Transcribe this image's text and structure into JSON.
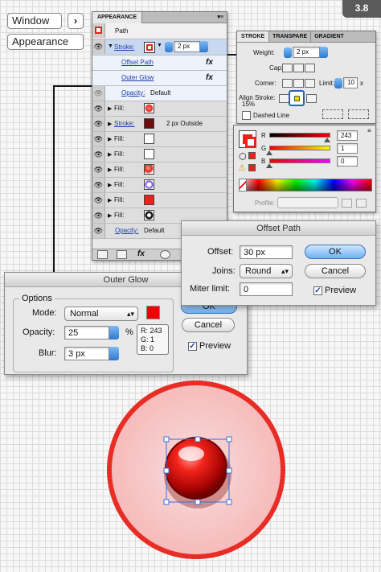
{
  "header": {
    "window_label": "Window",
    "arrow": "›",
    "appearance_label": "Appearance",
    "step": "3.8"
  },
  "appearance": {
    "tab": "APPEARANCE",
    "menu_glyph": "▾≡",
    "path_label": "Path",
    "stroke_row": {
      "label": "Stroke:",
      "weight": "2 px",
      "color": "#e8231b"
    },
    "offset_link": "Offset Path",
    "glow_link": "Outer Glow",
    "fx": "fx",
    "opacity_label": "Opacity:",
    "opacity_value": "Default",
    "fills": [
      {
        "label": "Fill:",
        "color": "#ffffff",
        "style": "gradient"
      },
      {
        "label": "Stroke:",
        "color": "#6e0c0c",
        "style": "solid",
        "extra": "2 px  Outside"
      },
      {
        "label": "Fill:",
        "color": "#ffffff",
        "style": "solid"
      },
      {
        "label": "Fill:",
        "color": "#ffffff",
        "style": "solid"
      },
      {
        "label": "Fill:",
        "color": "#e8231b",
        "style": "ball"
      },
      {
        "label": "Fill:",
        "color": "#6a3bd9",
        "style": "ring"
      },
      {
        "label": "Fill:",
        "color": "#e8231b",
        "style": "solid"
      },
      {
        "label": "Fill:",
        "color": "#1a1a1a",
        "style": "dark"
      }
    ],
    "bottom_opacity_label": "Opacity:",
    "bottom_opacity_value": "Default",
    "bottom_fx": "fx"
  },
  "stroke_panel": {
    "tabs": [
      "STROKE",
      "TRANSPARE",
      "GRADIENT"
    ],
    "weight_label": "Weight:",
    "weight_value": "2 px",
    "cap_label": "Cap:",
    "corner_label": "Corner:",
    "limit_label": "Limit:",
    "limit_value": "10",
    "x": "x",
    "align_label": "Align Stroke:",
    "pct": "15%",
    "dashed_label": "Dashed Line"
  },
  "color_panel": {
    "channels": [
      {
        "label": "R",
        "value": "243"
      },
      {
        "label": "G",
        "value": "1"
      },
      {
        "label": "B",
        "value": "0"
      }
    ],
    "profile_label": "Profile:",
    "accent": "#f30100",
    "warning_icon": "⚠"
  },
  "outer_glow": {
    "title": "Outer Glow",
    "options_label": "Options",
    "mode_label": "Mode:",
    "mode_value": "Normal",
    "opacity_label": "Opacity:",
    "opacity_value": "25",
    "pct": "%",
    "blur_label": "Blur:",
    "blur_value": "3 px",
    "ok": "OK",
    "cancel": "Cancel",
    "preview": "Preview",
    "swatch": "#f30100",
    "readout": [
      "R: 243",
      "G: 1",
      "B: 0"
    ]
  },
  "offset_path": {
    "title": "Offset Path",
    "offset_label": "Offset:",
    "offset_value": "30 px",
    "joins_label": "Joins:",
    "joins_value": "Round",
    "miter_label": "Miter limit:",
    "miter_value": "0",
    "ok": "OK",
    "cancel": "Cancel",
    "preview": "Preview"
  },
  "artwork": {
    "ring_color": "#e8231b",
    "halo_color": "#f9cfcf",
    "ball_color": "#d8100c"
  }
}
